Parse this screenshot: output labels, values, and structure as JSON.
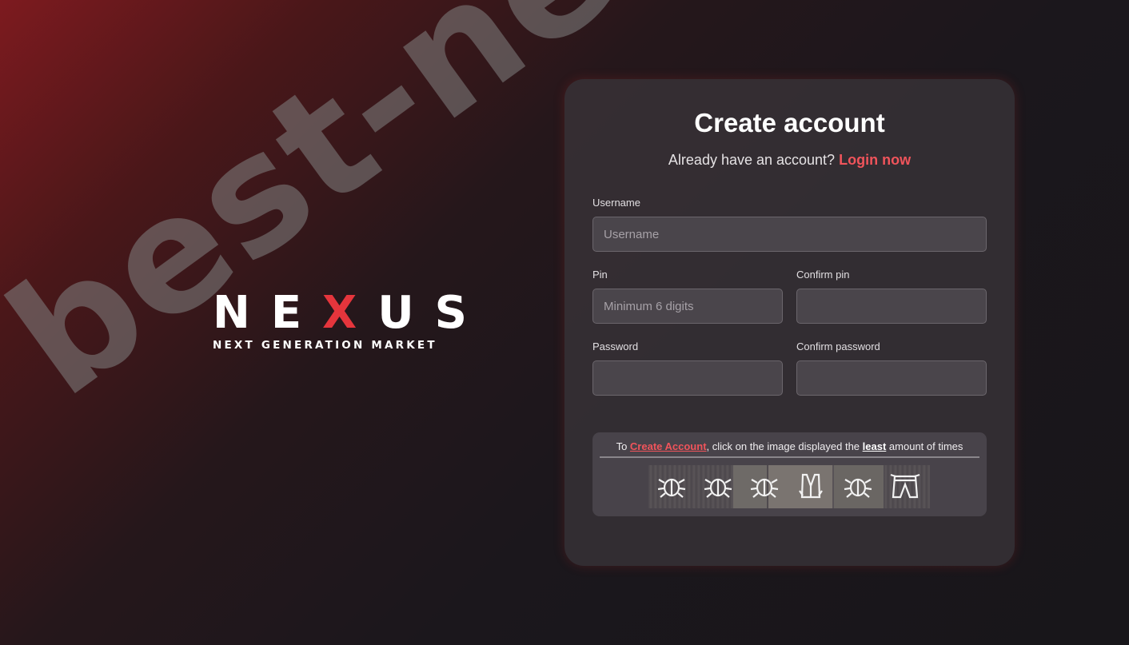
{
  "watermark": {
    "text": "best-nexus.icu"
  },
  "logo": {
    "letters": [
      "N",
      "E",
      "X",
      "U",
      "S"
    ],
    "tagline": "NEXT GENERATION MARKET",
    "accent_color": "#e5353c"
  },
  "form": {
    "title": "Create account",
    "subtitle_prefix": "Already have an account?",
    "login_link": "Login now",
    "fields": {
      "username": {
        "label": "Username",
        "placeholder": "Username",
        "value": ""
      },
      "pin": {
        "label": "Pin",
        "placeholder": "Minimum 6 digits",
        "value": ""
      },
      "confirm_pin": {
        "label": "Confirm pin",
        "placeholder": "",
        "value": ""
      },
      "password": {
        "label": "Password",
        "placeholder": "",
        "value": ""
      },
      "confirm_password": {
        "label": "Confirm password",
        "placeholder": "",
        "value": ""
      }
    },
    "captcha": {
      "text_before": "To",
      "action_link": "Create Account",
      "text_middle": ", click on the image displayed the",
      "emphasis": "least",
      "text_after": "amount of times",
      "icons": [
        "beetle-icon",
        "beetle-icon",
        "beetle-icon",
        "vest-icon",
        "beetle-icon",
        "pants-icon"
      ]
    }
  },
  "colors": {
    "accent": "#f0545b",
    "card": "#3c363c"
  }
}
